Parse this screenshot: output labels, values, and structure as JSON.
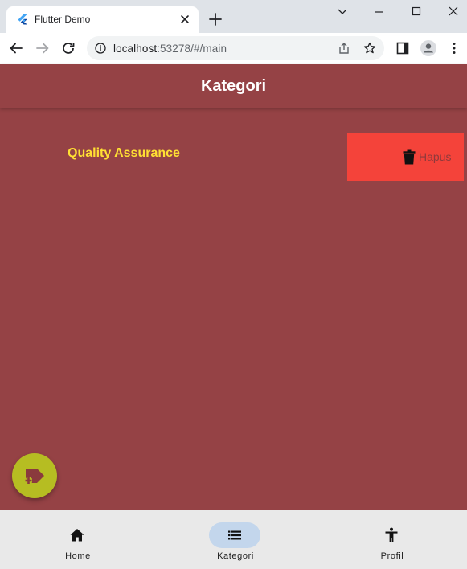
{
  "browser": {
    "tab": {
      "title": "Flutter Demo",
      "favicon": "flutter-logo-icon"
    },
    "url": {
      "host": "localhost",
      "rest": ":53278/#/main"
    }
  },
  "app": {
    "appbar": {
      "title": "Kategori"
    },
    "categories": [
      {
        "name": "Quality Assurance",
        "delete_label": "Hapus",
        "delete_icon": "trash-icon"
      }
    ],
    "fab": {
      "icon": "add-label-icon"
    },
    "bottom_nav": {
      "items": [
        {
          "label": "Home",
          "icon": "home-icon",
          "active": false
        },
        {
          "label": "Kategori",
          "icon": "list-icon",
          "active": true
        },
        {
          "label": "Profil",
          "icon": "person-icon",
          "active": false
        }
      ]
    }
  },
  "colors": {
    "app_background": "#954245",
    "item_title": "#ffe033",
    "delete_background": "#f4433a",
    "fab": "#b6bd22",
    "bottom_nav": "#e9e9e9",
    "nav_active_pill": "#c3d6ec"
  }
}
